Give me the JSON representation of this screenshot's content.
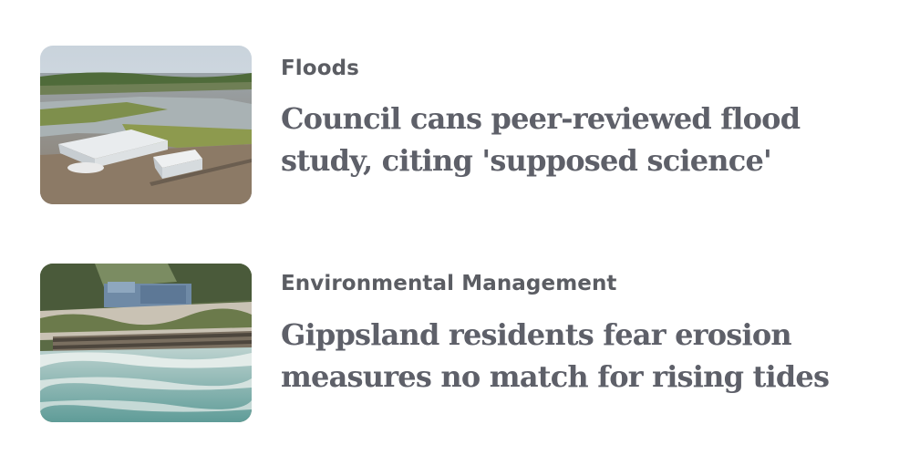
{
  "stories": [
    {
      "category": "Floods",
      "headline": "Council cans peer-reviewed flood study, citing 'supposed science'",
      "image_icon": "flooded-house-photo"
    },
    {
      "category": "Environmental Management",
      "headline": "Gippsland residents fear erosion measures no match for rising tides",
      "image_icon": "coastal-erosion-photo"
    }
  ],
  "colors": {
    "category_text": "#5b5d63",
    "headline_text": "#5e6069",
    "background": "#ffffff"
  }
}
